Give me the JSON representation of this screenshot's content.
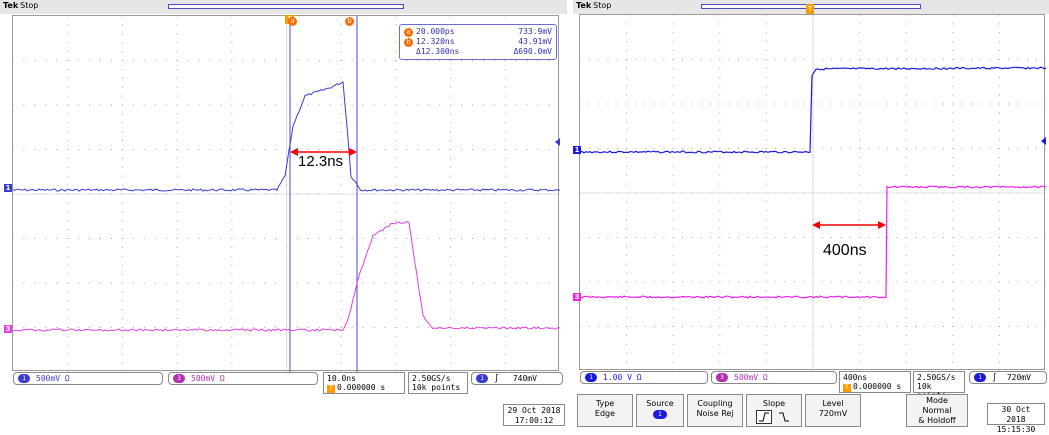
{
  "left_scope": {
    "brand": "Tek",
    "state": "Stop",
    "markers": {
      "trigger": "T",
      "cursor_a": "a",
      "cursor_b": "b"
    },
    "readout": {
      "rows": [
        {
          "label": "a",
          "time": "20.000ps",
          "value": "733.9mV"
        },
        {
          "label": "b",
          "time": "12.320ns",
          "value": "43.91mV"
        },
        {
          "label": "",
          "time": "Δ12.300ns",
          "value": "Δ690.0mV"
        }
      ]
    },
    "annotation": "12.3ns",
    "ch1_tag": "1",
    "ch3_tag": "3",
    "ch1_scale": "500mV Ω",
    "ch1_chip": "1",
    "ch3_scale": "500mV Ω",
    "ch3_chip": "3",
    "timebase": "10.0ns",
    "trig_pos": "0.000000 s",
    "sample_rate": "2.50GS/s",
    "record_len": "10k points",
    "trig_chip": "1",
    "trig_slope": "∫",
    "trig_level": "740mV",
    "date": "29 Oct  2018",
    "time": "17:00:12",
    "colors": {
      "ch1": "#3b3bd4",
      "ch3": "#e040e0",
      "cursor": "#4a4ad0",
      "accent": "#ff6a00"
    }
  },
  "right_scope": {
    "brand": "Tek",
    "state": "Stop",
    "markers": {
      "trigger": "T"
    },
    "annotation": "400ns",
    "ch1_tag": "1",
    "ch3_tag": "3",
    "ch1_scale": "1.00 V  Ω",
    "ch1_chip": "1",
    "ch3_scale": "500mV Ω",
    "ch3_chip": "3",
    "timebase": "400ns",
    "trig_pos": "0.000000 s",
    "sample_rate": "2.50GS/s",
    "record_len": "10k points",
    "trig_chip": "1",
    "trig_slope": "∫",
    "trig_level": "720mV",
    "menu": {
      "type_label": "Type",
      "type_value": "Edge",
      "source_label": "Source",
      "source_value": "1",
      "coupling_label": "Coupling",
      "coupling_value": "Noise Rej",
      "slope_label": "Slope",
      "level_label": "Level",
      "level_value": "720mV",
      "mode_label": "Mode",
      "mode_value1": "Normal",
      "mode_value2": "& Holdoff"
    },
    "date": "30 Oct  2018",
    "time": "15:15:30",
    "colors": {
      "ch1": "#1a1ae0",
      "ch3": "#f020f0"
    }
  }
}
